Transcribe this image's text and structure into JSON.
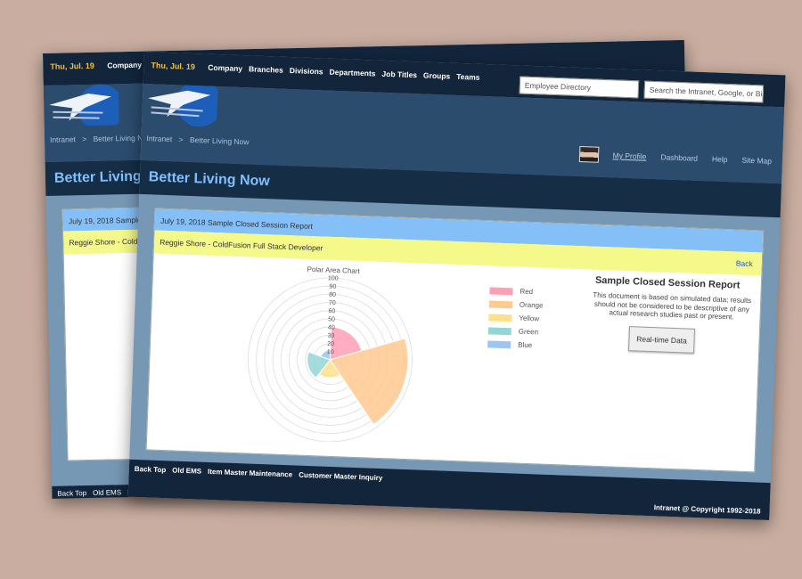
{
  "topbar": {
    "date": "Thu, Jul. 19",
    "nav": [
      "Company",
      "Branches",
      "Divisions",
      "Departments",
      "Job Titles",
      "Groups",
      "Teams"
    ],
    "employee_search_placeholder": "Employee Directory",
    "web_search_placeholder": "Search the Intranet, Google, or Bing"
  },
  "breadcrumb": [
    "Intranet",
    ">",
    "Better Living Now"
  ],
  "header_links": {
    "profile": "My Profile",
    "dashboard": "Dashboard",
    "help": "Help",
    "sitemap": "Site Map"
  },
  "page_title": "Better Living Now",
  "panel": {
    "head": "July 19, 2018 Sample Closed Session Report",
    "sub": "Reggie Shore - ColdFusion Full Stack Developer",
    "back_label": "Back"
  },
  "report": {
    "title": "Sample Closed Session Report",
    "text": "This document is based on simulated data; results should not be considered to be descriptive of any actual research studies past or present.",
    "button_label": "Real-time Data"
  },
  "footer": {
    "links": [
      "Back Top",
      "Old EMS",
      "Item Master Maintenance",
      "Customer Master Inquiry"
    ],
    "copyright": "Intranet @ Copyright 1992-2018"
  },
  "back_screen": {
    "nav_first": "Company",
    "panel_head": "July 19, 2018 Sample",
    "panel_sub": "Reggie Shore - ColdF",
    "breadcrumb": [
      "Intranet",
      ">",
      "Better Living Now"
    ]
  },
  "chart_data": {
    "type": "polar-area",
    "title": "Polar Area Chart",
    "categories": [
      "Red",
      "Orange",
      "Yellow",
      "Green",
      "Blue"
    ],
    "values": [
      40,
      95,
      22,
      28,
      12
    ],
    "colors": [
      "#ff9fb5",
      "#ffc98f",
      "#ffe08a",
      "#94d6d6",
      "#9cc5f5"
    ],
    "ticks": [
      10,
      20,
      30,
      40,
      50,
      60,
      70,
      80,
      90,
      100
    ],
    "ylim": [
      0,
      100
    ],
    "legend_position": "right"
  }
}
